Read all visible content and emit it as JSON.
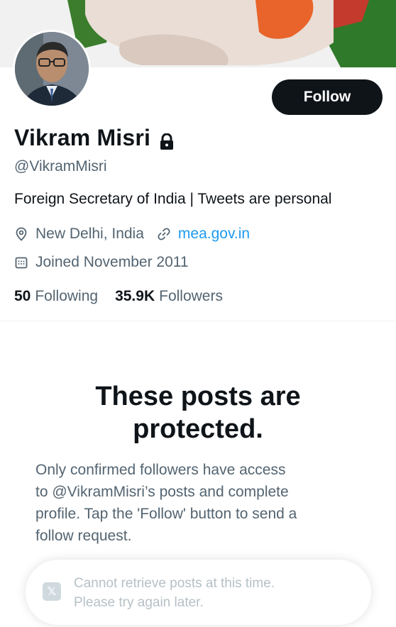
{
  "profile": {
    "name": "Vikram Misri",
    "handle": "@VikramMisri",
    "bio": "Foreign Secretary of India | Tweets are personal",
    "location": "New Delhi, India",
    "website": "mea.gov.in",
    "joined": "Joined November 2011",
    "following_count": "50",
    "following_label": "Following",
    "followers_count": "35.9K",
    "followers_label": "Followers"
  },
  "actions": {
    "follow_label": "Follow"
  },
  "protected": {
    "title_line1": "These posts are",
    "title_line2": "protected.",
    "body_line1": "Only confirmed followers have access",
    "body_line2": "to @VikramMisri’s posts and complete",
    "body_line3": "profile. Tap the 'Follow' button to send a",
    "body_line4": "follow request."
  },
  "toast": {
    "line1": "Cannot retrieve posts at this time.",
    "line2": "Please try again later."
  },
  "icons": {
    "lock": "lock-icon",
    "location": "location-pin-icon",
    "link": "link-icon",
    "calendar": "calendar-icon",
    "toast": "x-logo-icon"
  },
  "colors": {
    "accent": "#1d9bf0",
    "text_primary": "#0f1419",
    "text_secondary": "#536471",
    "button_bg": "#0f1419"
  }
}
